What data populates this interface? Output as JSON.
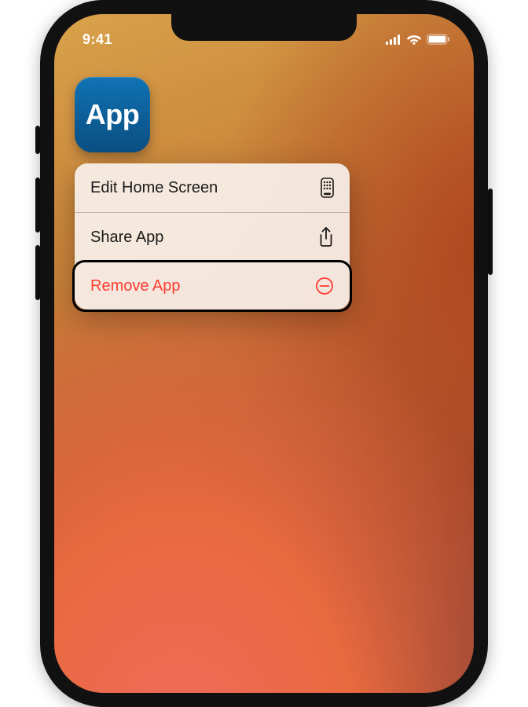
{
  "statusbar": {
    "time": "9:41"
  },
  "app": {
    "label": "App"
  },
  "menu": {
    "edit_label": "Edit Home Screen",
    "share_label": "Share App",
    "remove_label": "Remove App"
  }
}
